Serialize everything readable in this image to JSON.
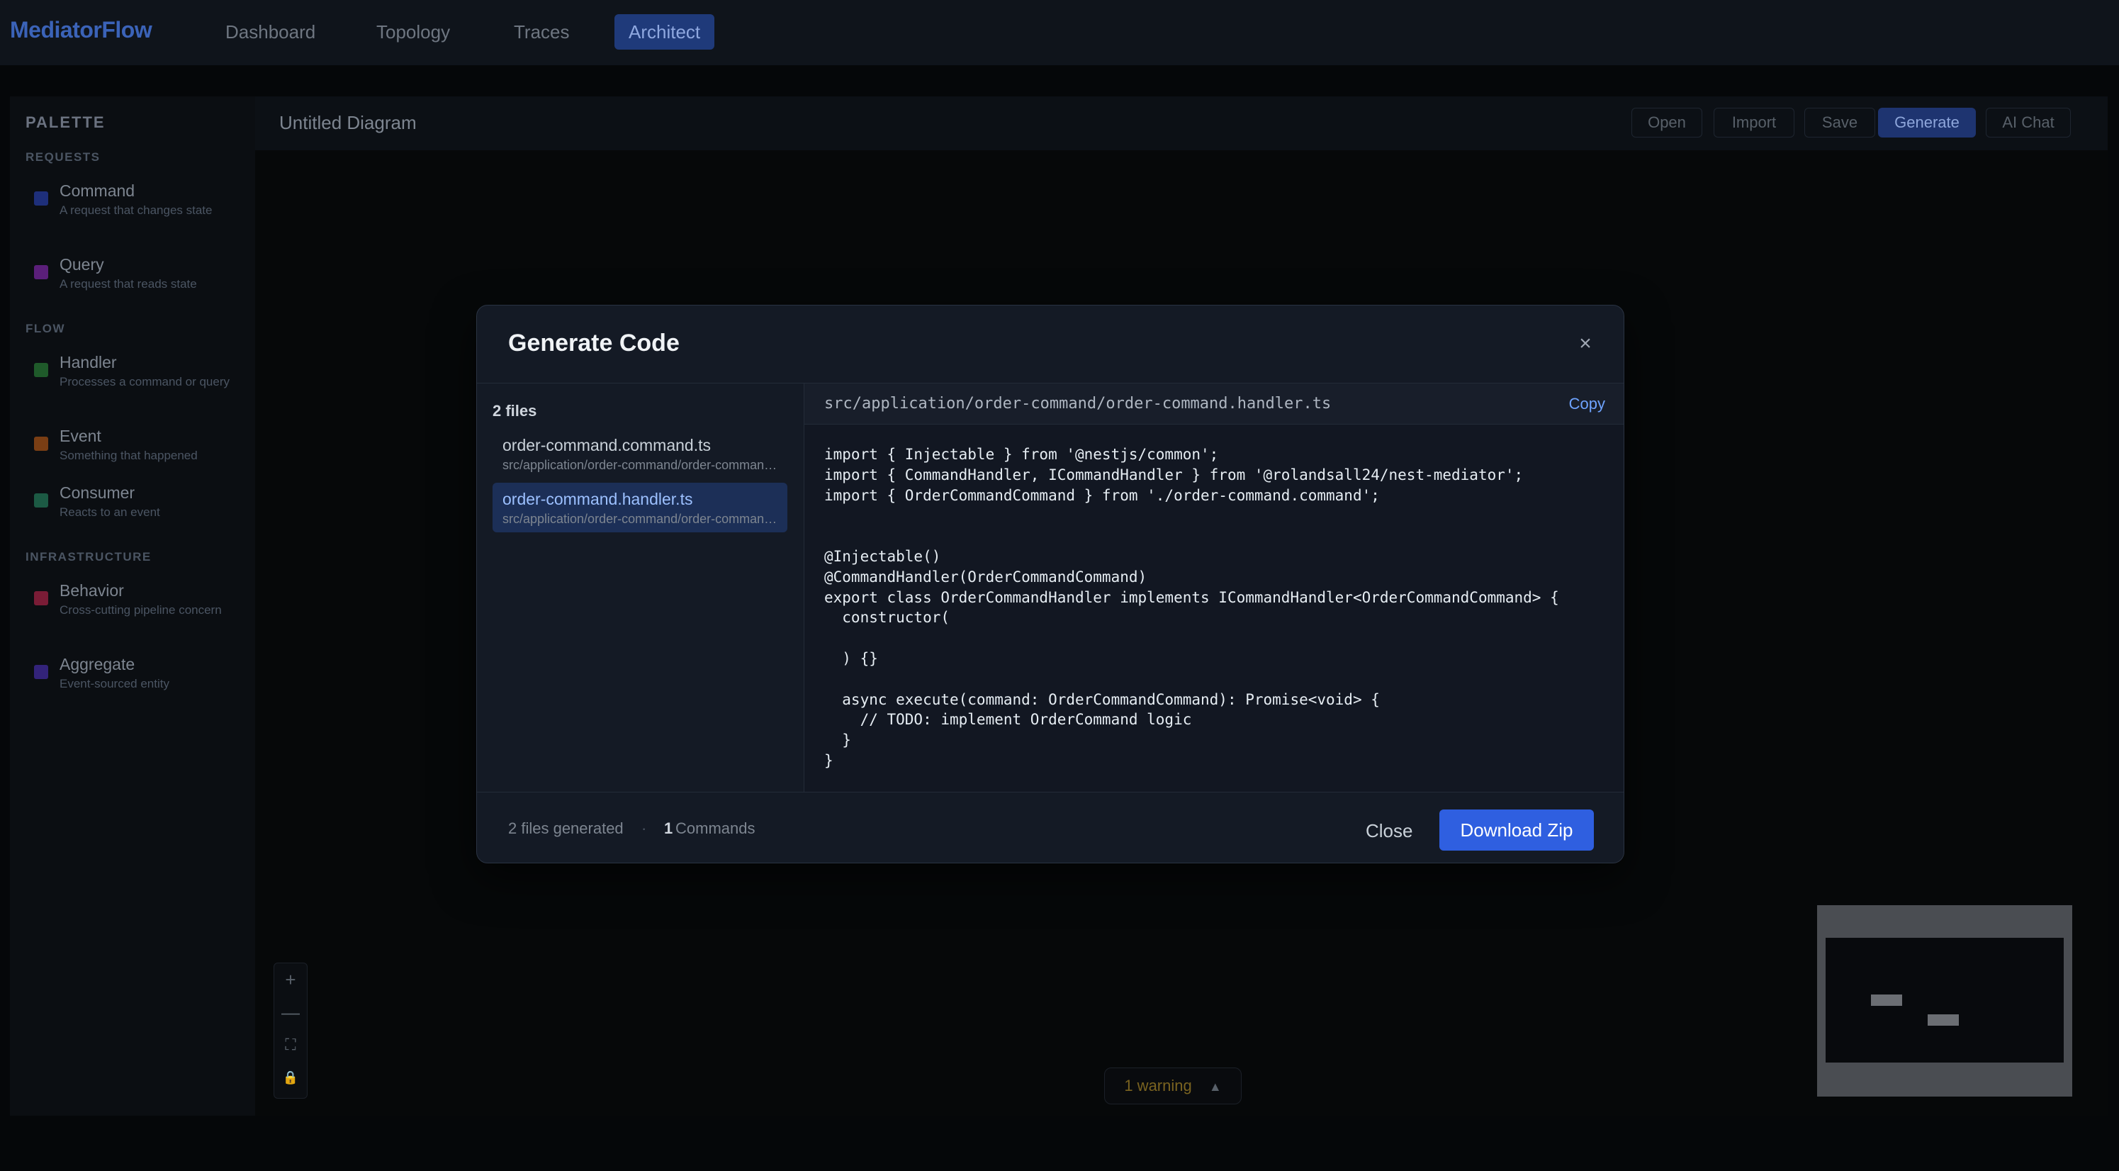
{
  "app": {
    "brand": "MediatorFlow"
  },
  "nav": {
    "tabs": [
      {
        "label": "Dashboard"
      },
      {
        "label": "Topology"
      },
      {
        "label": "Traces"
      },
      {
        "label": "Architect"
      }
    ],
    "active": "Architect"
  },
  "palette": {
    "title": "PALETTE",
    "groups": [
      {
        "label": "REQUESTS",
        "items": [
          {
            "name": "Command",
            "desc": "A request that changes state",
            "color": "#1e2f7a"
          },
          {
            "name": "Query",
            "desc": "A request that reads state",
            "color": "#5b1f7a"
          }
        ]
      },
      {
        "label": "FLOW",
        "items": [
          {
            "name": "Handler",
            "desc": "Processes a command or query",
            "color": "#1f5a2a"
          },
          {
            "name": "Event",
            "desc": "Something that happened",
            "color": "#7a3e14"
          },
          {
            "name": "Consumer",
            "desc": "Reacts to an event",
            "color": "#1c5a44"
          }
        ]
      },
      {
        "label": "INFRASTRUCTURE",
        "items": [
          {
            "name": "Behavior",
            "desc": "Cross-cutting pipeline concern",
            "color": "#7a1c36"
          },
          {
            "name": "Aggregate",
            "desc": "Event-sourced entity",
            "color": "#33237a"
          }
        ]
      }
    ]
  },
  "canvas": {
    "title": "Untitled Diagram",
    "buttons": {
      "open": "Open",
      "import": "Import",
      "save": "Save",
      "generate": "Generate",
      "ai_chat": "AI Chat"
    },
    "zoom": {
      "in": "+",
      "out": "—",
      "fit": "⛶",
      "lock": "🔒"
    },
    "warning": {
      "text": "1 warning",
      "icon": "▲"
    }
  },
  "modal": {
    "title": "Generate Code",
    "close_icon": "×",
    "files_count": "2 files",
    "files": [
      {
        "name": "order-command.command.ts",
        "path": "src/application/order-command/order-command.command.ts"
      },
      {
        "name": "order-command.handler.ts",
        "path": "src/application/order-command/order-command.handler.ts"
      }
    ],
    "active_file": "src/application/order-command/order-command.handler.ts",
    "copy_label": "Copy",
    "code": "import { Injectable } from '@nestjs/common';\nimport { CommandHandler, ICommandHandler } from '@rolandsall24/nest-mediator';\nimport { OrderCommandCommand } from './order-command.command';\n\n\n@Injectable()\n@CommandHandler(OrderCommandCommand)\nexport class OrderCommandHandler implements ICommandHandler<OrderCommandCommand> {\n  constructor(\n\n  ) {}\n\n  async execute(command: OrderCommandCommand): Promise<void> {\n    // TODO: implement OrderCommand logic\n  }\n}",
    "footer": {
      "files_generated": "2 files generated",
      "separator": "·",
      "commands_count": "1",
      "commands_label": "Commands",
      "close_label": "Close",
      "download_label": "Download Zip"
    }
  },
  "colors": {
    "accent": "#2f5fe0",
    "brand": "#3b63b8",
    "warning": "#7a6320"
  }
}
